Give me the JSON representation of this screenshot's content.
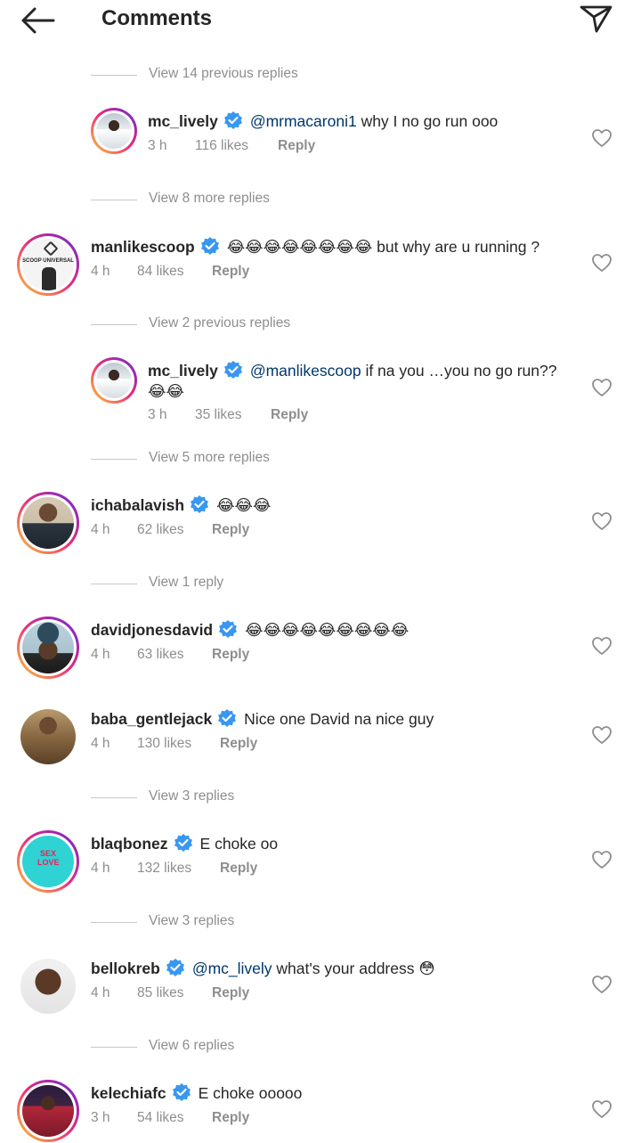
{
  "header": {
    "title": "Comments",
    "back_icon": "arrow-left-icon",
    "share_icon": "paper-plane-icon"
  },
  "colors": {
    "mention": "#00376b",
    "verified_badge": "#3897f0",
    "secondary_text": "#8e8e8e"
  },
  "threads": [
    {
      "view_label": "View 14 previous replies"
    },
    {
      "user": "mc_lively",
      "verified": true,
      "mention": "@mrmacaroni1",
      "text": " why I no go run ooo",
      "time": "3 h",
      "likes": "116 likes",
      "reply": "Reply"
    },
    {
      "view_label": "View 8 more replies"
    },
    {
      "user": "manlikescoop",
      "verified": true,
      "text": "😂😂😂😂😂😂😂😂 but why are u running ?",
      "time": "4 h",
      "likes": "84 likes",
      "reply": "Reply"
    },
    {
      "view_label": "View 2 previous replies"
    },
    {
      "user": "mc_lively",
      "verified": true,
      "mention": "@manlikescoop",
      "text": " if na you …you no go run??",
      "text2": "😂😂",
      "time": "3 h",
      "likes": "35 likes",
      "reply": "Reply"
    },
    {
      "view_label": "View 5 more replies"
    },
    {
      "user": "ichabalavish",
      "verified": true,
      "text": "😂😂😂",
      "time": "4 h",
      "likes": "62 likes",
      "reply": "Reply"
    },
    {
      "view_label": "View 1 reply"
    },
    {
      "user": "davidjonesdavid",
      "verified": true,
      "text": "😂😂😂😂😂😂😂😂😂",
      "time": "4 h",
      "likes": "63 likes",
      "reply": "Reply"
    },
    {
      "user": "baba_gentlejack",
      "verified": true,
      "text": "Nice one David na nice guy",
      "time": "4 h",
      "likes": "130 likes",
      "reply": "Reply"
    },
    {
      "view_label": "View 3 replies"
    },
    {
      "user": "blaqbonez",
      "verified": true,
      "text": "E choke oo",
      "time": "4 h",
      "likes": "132 likes",
      "reply": "Reply",
      "avatar_text": "SEX LOVE"
    },
    {
      "view_label": "View 3 replies"
    },
    {
      "user": "bellokreb",
      "verified": true,
      "mention": "@mc_lively",
      "text": " what's your address 😳",
      "time": "4 h",
      "likes": "85 likes",
      "reply": "Reply"
    },
    {
      "view_label": "View 6 replies"
    },
    {
      "user": "kelechiafc",
      "verified": true,
      "text": "E choke ooooo",
      "time": "3 h",
      "likes": "54 likes",
      "reply": "Reply"
    }
  ],
  "avatar_labels": {
    "manlikescoop": "SCOOP UNIVERSAL"
  }
}
